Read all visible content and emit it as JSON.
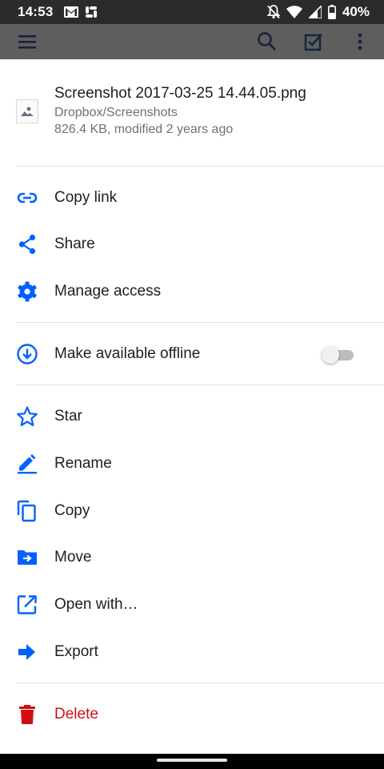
{
  "status_bar": {
    "time": "14:53",
    "battery": "40%",
    "icons_left": [
      "gmail-icon",
      "slack-icon"
    ],
    "icons_right": [
      "notifications-off-icon",
      "wifi-icon",
      "signal-icon",
      "battery-icon"
    ]
  },
  "app_bar": {
    "icons": [
      "menu-icon",
      "search-icon",
      "select-icon",
      "more-vert-icon"
    ]
  },
  "file": {
    "name": "Screenshot 2017-03-25 14.44.05.png",
    "path": "Dropbox/Screenshots",
    "meta": "826.4 KB, modified 2 years ago"
  },
  "actions": {
    "copy_link": "Copy link",
    "share": "Share",
    "manage_access": "Manage access",
    "make_offline": "Make available offline",
    "offline_enabled": false,
    "star": "Star",
    "rename": "Rename",
    "copy": "Copy",
    "move": "Move",
    "open_with": "Open with…",
    "export": "Export",
    "delete": "Delete"
  },
  "colors": {
    "accent": "#0061fe",
    "danger": "#d20f0f",
    "text": "#1e1e1e",
    "secondary_text": "#707070"
  }
}
